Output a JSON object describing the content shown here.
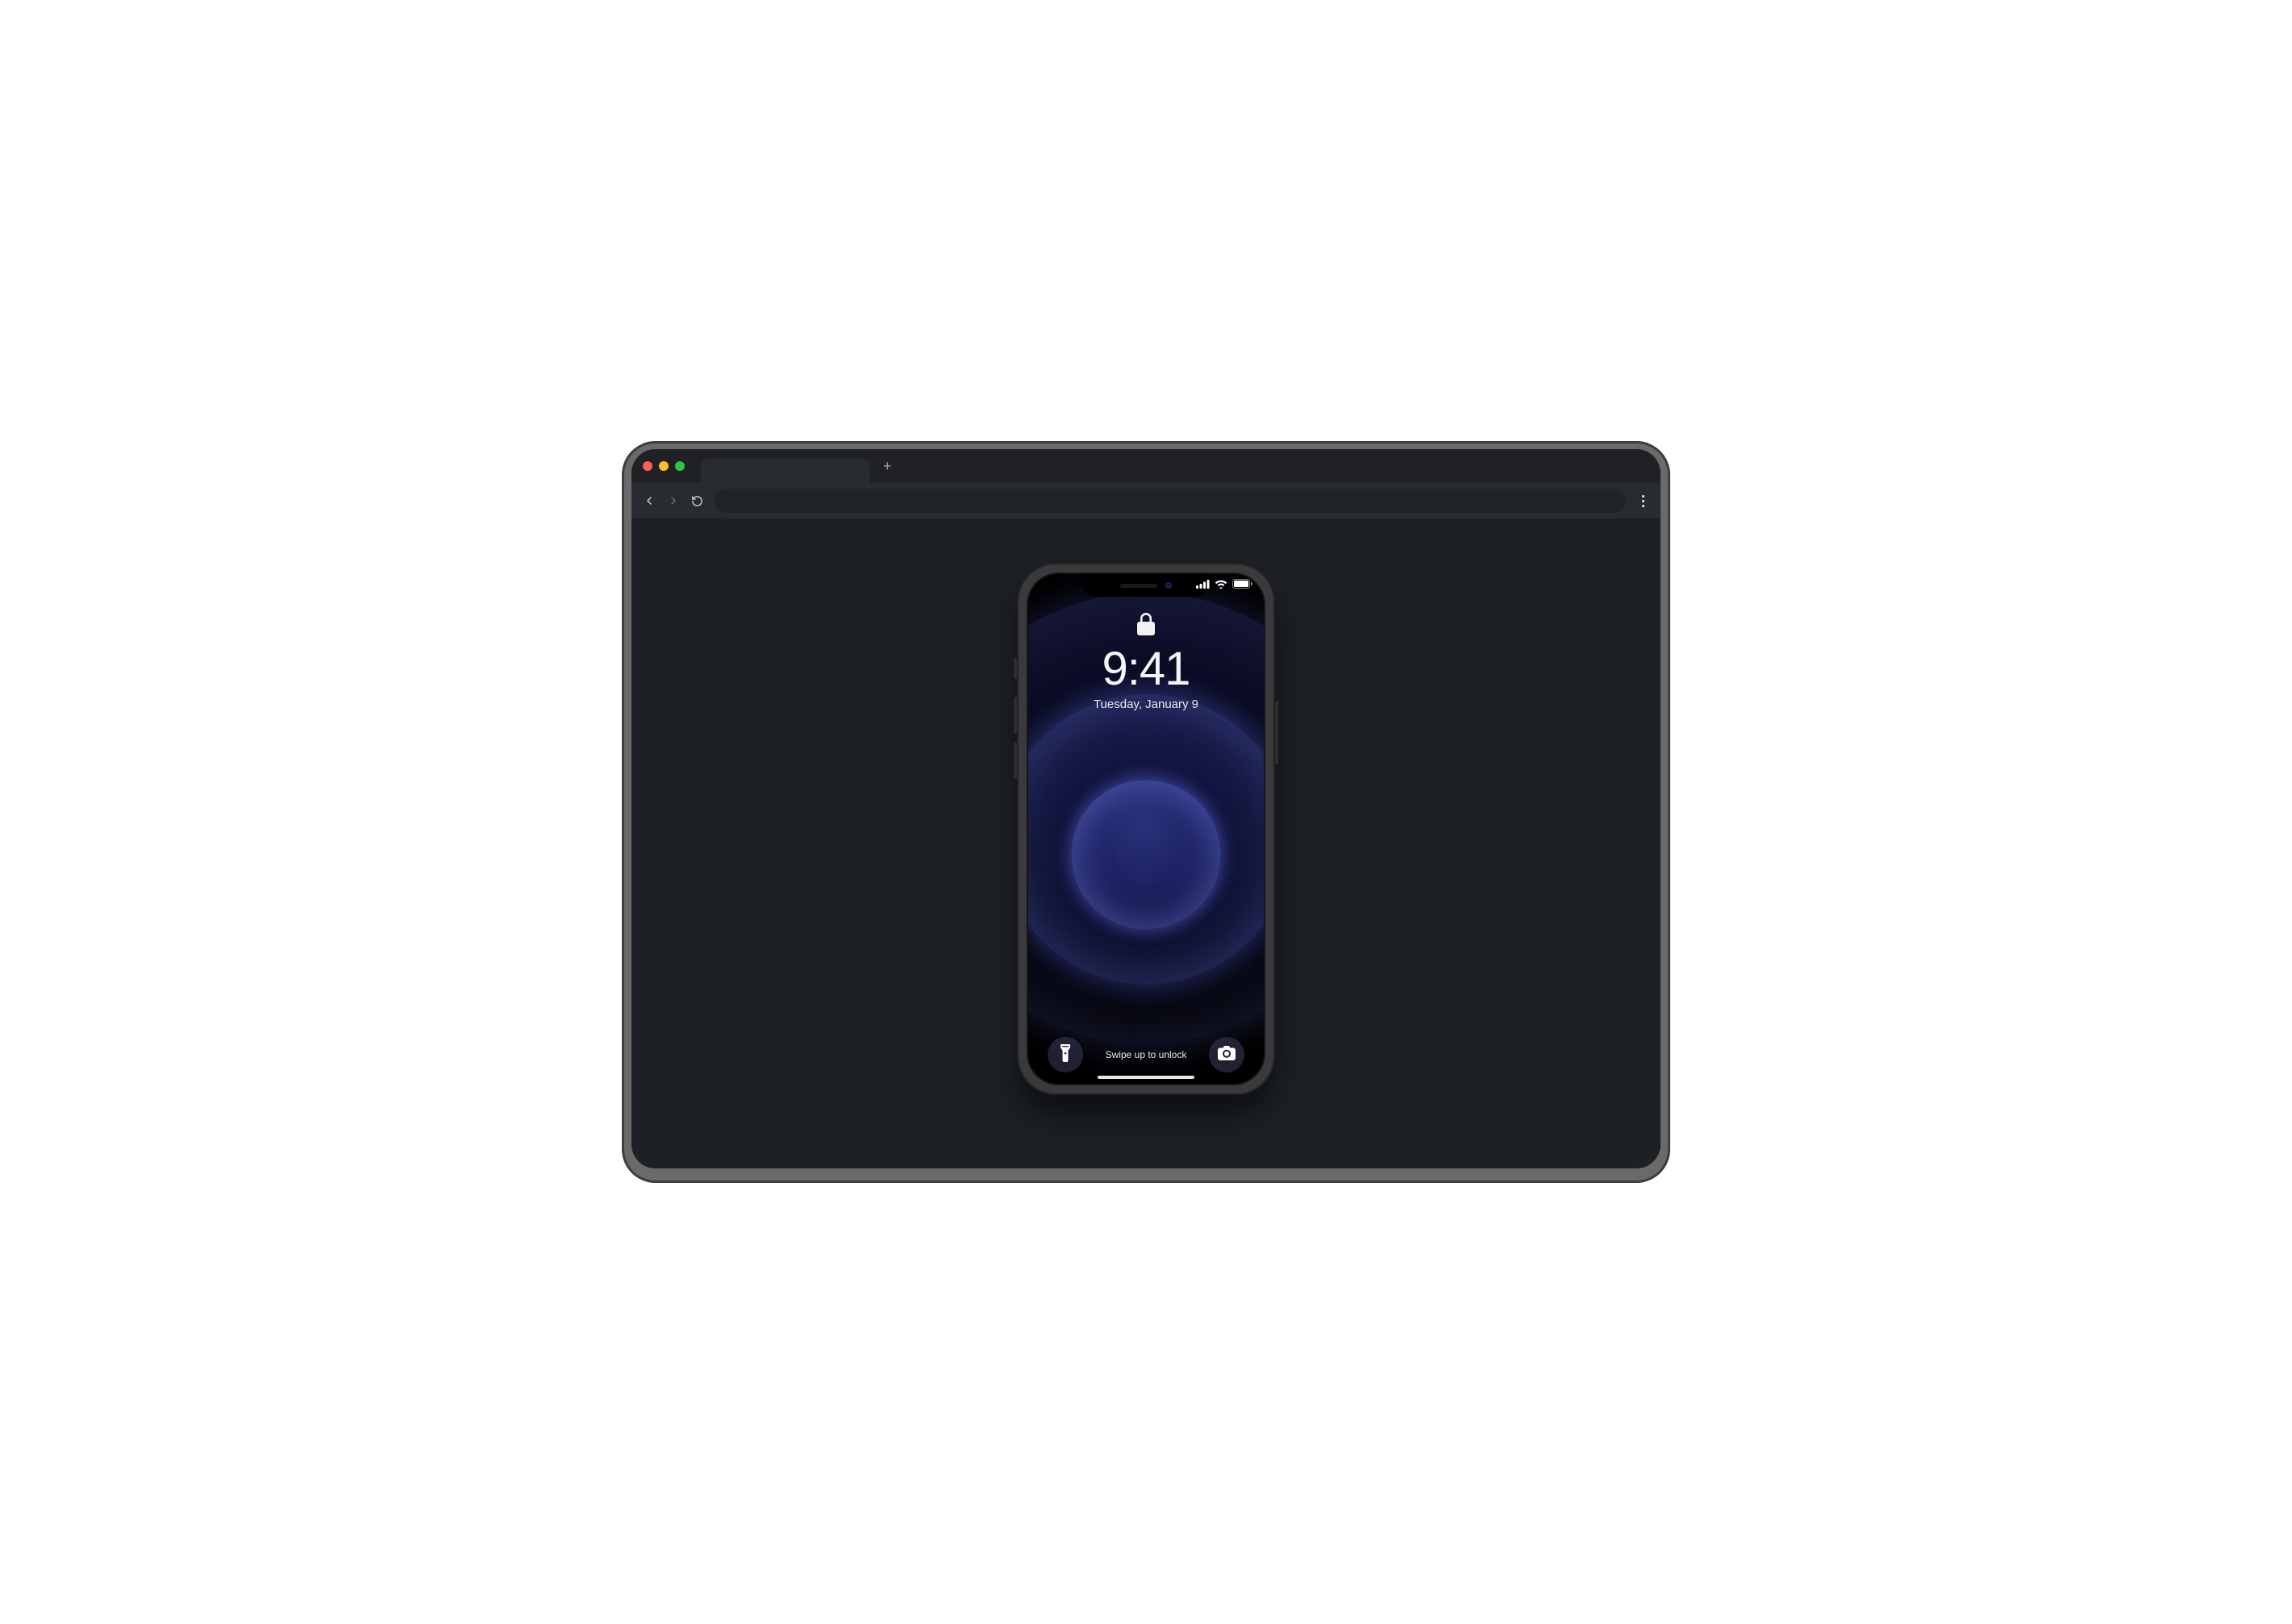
{
  "browser": {
    "new_tab_glyph": "+"
  },
  "lockscreen": {
    "time": "9:41",
    "date": "Tuesday, January 9",
    "swipe_hint": "Swipe up to unlock"
  }
}
